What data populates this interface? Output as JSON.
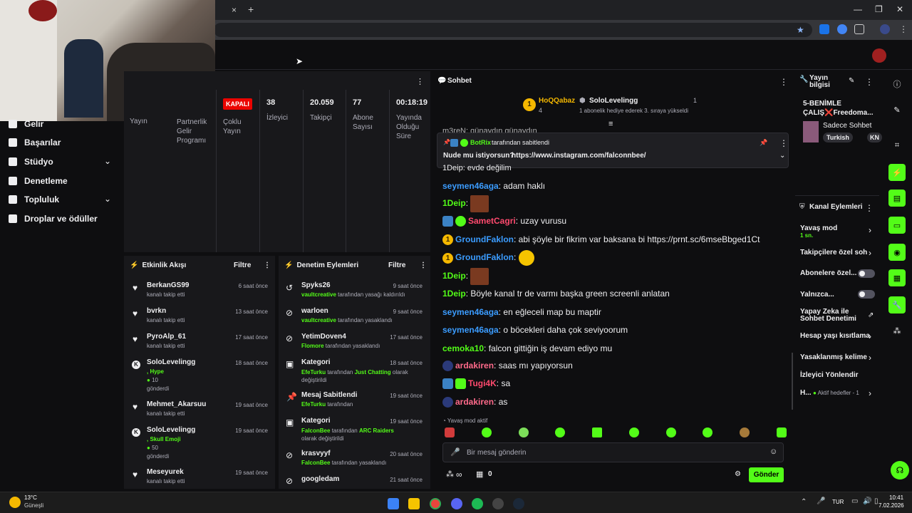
{
  "browser": {
    "tab_close": "×",
    "tab_add": "+",
    "min": "—",
    "max": "❐",
    "close": "✕"
  },
  "nav": {
    "items": [
      {
        "label": "Gelir"
      },
      {
        "label": "Başarılar"
      },
      {
        "label": "Stüdyo"
      },
      {
        "label": "Denetleme"
      },
      {
        "label": "Topluluk"
      },
      {
        "label": "Droplar ve ödüller"
      }
    ]
  },
  "stats_panel": {
    "left_labels": [
      "Yayın",
      "Partnerlik Gelir Programı"
    ],
    "status_badge": "KAPALI",
    "multi_stream": "Çoklu Yayın",
    "stats": [
      {
        "value": "38",
        "label": "İzleyici"
      },
      {
        "value": "20.059",
        "label": "Takipçi"
      },
      {
        "value": "77",
        "label": "Abone Sayısı"
      },
      {
        "value": "00:18:19",
        "label": "Yayında Olduğu Süre"
      }
    ]
  },
  "activity": {
    "title": "Etkinlik Akışı",
    "filter": "Filtre",
    "rows": [
      {
        "name": "BerkanGS99",
        "sub": "kanalı takip etti",
        "time": "6 saat önce"
      },
      {
        "name": "bvrkn",
        "sub": "kanalı takip etti",
        "time": "13 saat önce"
      },
      {
        "name": "PyroAlp_61",
        "sub": "kanalı takip etti",
        "time": "17 saat önce"
      },
      {
        "name": "SoloLevelingg",
        "sub": ", Hype",
        "extra": "10",
        "extra2": "gönderdi",
        "time": "18 saat önce"
      },
      {
        "name": "Mehmet_Akarsuu",
        "sub": "kanalı takip etti",
        "time": "19 saat önce"
      },
      {
        "name": "SoloLevelingg",
        "sub": ", Skull Emoji",
        "extra": "50",
        "extra2": "gönderdi",
        "time": "19 saat önce"
      },
      {
        "name": "Meseyurek",
        "sub": "kanalı takip etti",
        "time": "19 saat önce"
      }
    ]
  },
  "moderation": {
    "title": "Denetim Eylemleri",
    "filter": "Filtre",
    "rows": [
      {
        "name": "Spyks26",
        "by": "vaultcreative",
        "action": "tarafından yasağı kaldırıldı",
        "time": "9 saat önce"
      },
      {
        "name": "warloen",
        "by": "vaultcreative",
        "action": "tarafından yasaklandı",
        "time": "9 saat önce"
      },
      {
        "name": "YetimDoven4",
        "by": "Flomore",
        "action": "tarafından yasaklandı",
        "time": "17 saat önce"
      },
      {
        "name": "Kategori",
        "by": "EfeTurku",
        "action": "tarafından",
        "target": "Just Chatting",
        "action2": "olarak değiştirildi",
        "time": "18 saat önce"
      },
      {
        "name": "Mesaj Sabitlendi",
        "by": "EfeTurku",
        "action": "tarafından",
        "time": "19 saat önce"
      },
      {
        "name": "Kategori",
        "by": "FalconBee",
        "action": "tarafından",
        "target": "ARC Raiders",
        "action2": "olarak değiştirildi",
        "time": "19 saat önce"
      },
      {
        "name": "krasvyyf",
        "by": "FalconBee",
        "action": "tarafından yasaklandı",
        "time": "20 saat önce"
      },
      {
        "name": "googledam",
        "time": "21 saat önce"
      }
    ]
  },
  "chat": {
    "title": "Sohbet",
    "leader1": {
      "rank": "1",
      "name": "HoQQabaz",
      "count": "4"
    },
    "leader2": {
      "name": "SoloLevelingg",
      "count": "1",
      "note": "1 abonelik hediye ederek 3. sıraya yükseldi"
    },
    "pinned": {
      "by": "BotRix",
      "by_suffix": "tarafından sabitlendi",
      "text": "Nude mu istiyorsun?",
      "link": "https://www.instagram.com/falconnbee/"
    },
    "partial_top": "m3reN: günaydın günaydın",
    "partial_second": "1Deip: evde değilim",
    "messages": [
      {
        "user": "seymen46aga",
        "color": "#3b9cff",
        "text": "adam haklı"
      },
      {
        "user": "1Deip",
        "color": "#53fc18",
        "text": ""
      },
      {
        "user": "SametCagri",
        "color": "#ff4a6e",
        "text": "uzay vurusu"
      },
      {
        "user": "GroundFaklon",
        "color": "#3b9cff",
        "text": "abi şöyle bir fikrim var baksana bi",
        "link": "https://prnt.sc/6mseBbged1Ct"
      },
      {
        "user": "GroundFaklon",
        "color": "#3b9cff",
        "text": ""
      },
      {
        "user": "1Deip",
        "color": "#53fc18",
        "text": ""
      },
      {
        "user": "1Deip",
        "color": "#53fc18",
        "text": "Böyle kanal tr de varmı başka green screenli anlatan"
      },
      {
        "user": "seymen46aga",
        "color": "#3b9cff",
        "text": "en eğleceli map bu maptir"
      },
      {
        "user": "seymen46aga",
        "color": "#3b9cff",
        "text": "o böcekleri daha çok seviyoorum"
      },
      {
        "user": "cemoka10",
        "color": "#53fc18",
        "text": "falcon gittiğin iş devam ediyo mu"
      },
      {
        "user": "ardakiren",
        "color": "#ff6a8a",
        "text": "saas mı yapıyorsun"
      },
      {
        "user": "Tugi4K",
        "color": "#ff4a6e",
        "text": "sa"
      },
      {
        "user": "ardakiren",
        "color": "#ff6a8a",
        "text": "as"
      }
    ],
    "slow_mode_note": "Yavaş mod aktif",
    "input_placeholder": "Bir mesaj gönderin",
    "points_label": "∞",
    "store_count": "0",
    "send_label": "Gönder"
  },
  "stream_info": {
    "title": "Yayın bilgisi",
    "stream_title": "5-BENİMLE ÇALIŞ❌Freedoma...",
    "category": "Sadece Sohbet",
    "tags": [
      "Turkish",
      "KN"
    ]
  },
  "channel_actions": {
    "title": "Kanal Eylemleri",
    "slow_mode": "Yavaş mod",
    "slow_mode_sub": "1 sn.",
    "followers_only": "Takipçilere özel soh",
    "subs_only": "Abonelere özel...",
    "only": "Yalnızca...",
    "ai_mod": "Yapay Zeka ile Sohbet Denetimi",
    "account_age": "Hesap yaşı kısıtlama",
    "banned_words": "Yasaklanmış kelime",
    "viewer_redirect": "İzleyici Yönlendir",
    "goals": "H...",
    "goals_sub": "Aktif hedefler - 1"
  },
  "taskbar": {
    "weather_temp": "13°C",
    "weather_desc": "Güneşli",
    "lang": "TUR",
    "time": "10:41",
    "date": "7.02.2026"
  },
  "colors": {
    "accent": "#53fc18",
    "bg": "#0e0e10",
    "panel": "#18181b",
    "live_badge": "#eb0400"
  }
}
